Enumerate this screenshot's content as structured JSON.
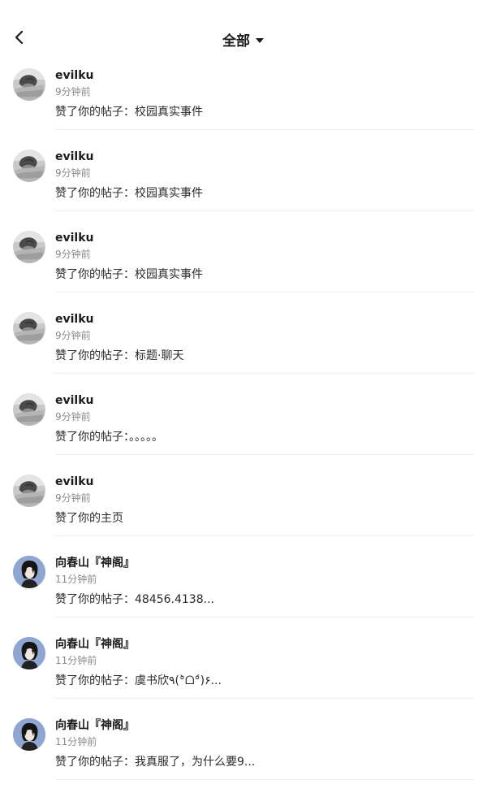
{
  "header": {
    "back_icon": "chevron-left-icon",
    "filter_label": "全部",
    "filter_icon": "caret-down-icon"
  },
  "notifications": [
    {
      "name": "evilku",
      "time": "9分钟前",
      "message": "赞了你的帖子：校园真实事件",
      "avatar": "grey-photo-avatar"
    },
    {
      "name": "evilku",
      "time": "9分钟前",
      "message": "赞了你的帖子：校园真实事件",
      "avatar": "grey-photo-avatar"
    },
    {
      "name": "evilku",
      "time": "9分钟前",
      "message": "赞了你的帖子：校园真实事件",
      "avatar": "grey-photo-avatar"
    },
    {
      "name": "evilku",
      "time": "9分钟前",
      "message": "赞了你的帖子：标题·聊天",
      "avatar": "grey-photo-avatar"
    },
    {
      "name": "evilku",
      "time": "9分钟前",
      "message": "赞了你的帖子：。。。。。",
      "avatar": "grey-photo-avatar"
    },
    {
      "name": "evilku",
      "time": "9分钟前",
      "message": "赞了你的主页",
      "avatar": "grey-photo-avatar"
    },
    {
      "name": "向春山『神阁』",
      "time": "11分钟前",
      "message": "赞了你的帖子：48456.4138...",
      "avatar": "blue-anime-avatar"
    },
    {
      "name": "向春山『神阁』",
      "time": "11分钟前",
      "message": "赞了你的帖子：虞书欣٩(°̀ᗝ°́)۶...",
      "avatar": "blue-anime-avatar"
    },
    {
      "name": "向春山『神阁』",
      "time": "11分钟前",
      "message": "赞了你的帖子：我真服了，为什么要9...",
      "avatar": "blue-anime-avatar"
    }
  ],
  "colors": {
    "background": "#ffffff",
    "text_primary": "#1a1a1a",
    "text_secondary": "#8a8a8a",
    "divider": "#ececec"
  }
}
